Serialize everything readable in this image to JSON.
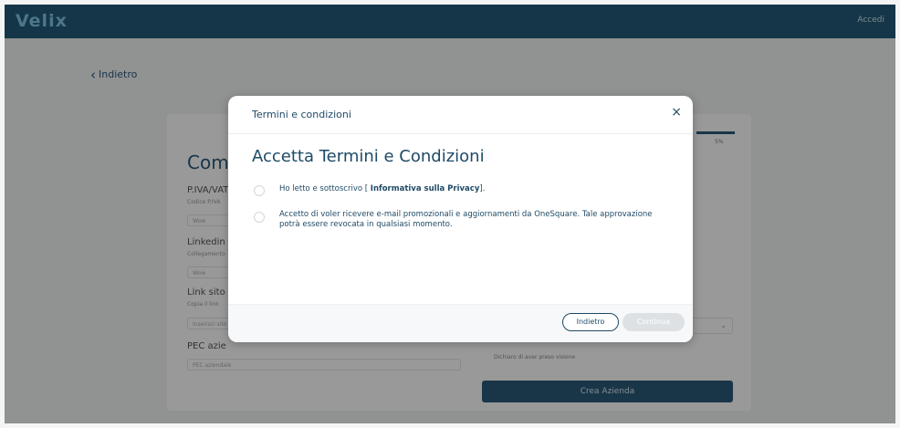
{
  "app": {
    "logo": "Velix",
    "login": "Accedi"
  },
  "page": {
    "back_label": "Indietro",
    "card_title": "Comp",
    "progress_text": "5%",
    "fields": [
      {
        "label": "P.IVA/VAT",
        "hint": "Codice P.IVA",
        "value": "Wow"
      },
      {
        "label": "Linkedin",
        "hint": "Collegamento",
        "value": "Wow"
      },
      {
        "label": "Link sito w",
        "hint": "Copia il link",
        "value": "Inserisci sito"
      }
    ],
    "pec_label": "PEC azie",
    "pec_placeholder": "PEC aziendale",
    "select_arrow": "⌄",
    "check_text": "Dichiaro di aver preso visione",
    "create_button": "Crea Azienda"
  },
  "modal": {
    "title": "Termini e condizioni",
    "close_icon": "×",
    "heading": "Accetta Termini e Condizioni",
    "options": [
      {
        "prefix": "Ho letto e sottoscrivo [ ",
        "link": "Informativa sulla Privacy",
        "suffix": "]."
      },
      {
        "text": "Accetto di voler ricevere e-mail promozionali e aggiornamenti da OneSquare. Tale approvazione potrà essere revocata in qualsiasi momento."
      }
    ],
    "back_button": "Indietro",
    "continue_button": "Continua"
  },
  "colors": {
    "accent": "#1e4a66",
    "topbar": "#235a78",
    "logo": "#7ec6e8"
  }
}
